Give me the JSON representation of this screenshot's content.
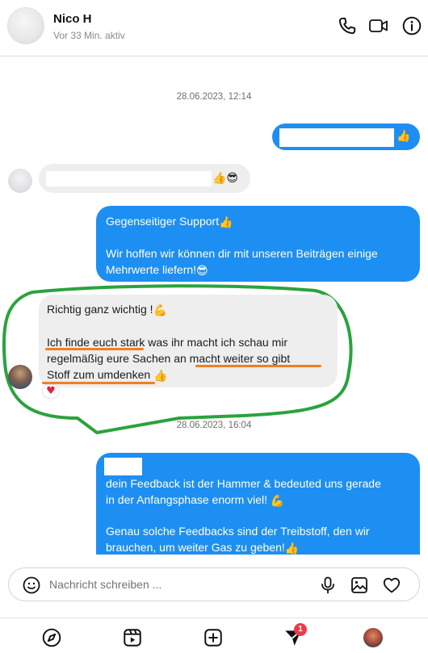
{
  "header": {
    "name": "Nico H",
    "status": "Vor 33 Min. aktiv"
  },
  "timestamps": {
    "first": "28.06.2023, 12:14",
    "second": "28.06.2023, 16:04"
  },
  "messages": {
    "out1": {
      "emoji": "👍"
    },
    "in1": {
      "emoji": "👍😎"
    },
    "out2": {
      "line1": "Gegenseitiger Support",
      "line1_emoji": "👍",
      "line2": "Wir hoffen wir können dir mit unseren Beiträgen einige",
      "line3": "Mehrwerte liefern!",
      "line3_emoji": "😎"
    },
    "in2": {
      "line1": "Richtig ganz wichtig !",
      "line1_emoji": "💪",
      "line2": "Ich finde euch stark was ihr macht ich schau mir",
      "line3": "regelmäßig eure Sachen an macht weiter so gibt",
      "line4": "Stoff zum umdenken",
      "line4_emoji": "👍",
      "reaction": "♥"
    },
    "out3": {
      "line1": "dein Feedback ist der Hammer & bedeuted uns gerade",
      "line2": "in der Anfangsphase enorm viel!",
      "line2_emoji": "💪",
      "line3": "Genau solche Feedbacks sind der Treibstoff, den wir",
      "line4": "brauchen, um weiter Gas zu geben!",
      "line4_emoji": "👍"
    }
  },
  "composer": {
    "placeholder": "Nachricht schreiben ..."
  },
  "nav": {
    "badge_count": "1"
  },
  "colors": {
    "outgoing_bubble": "#1d8ff2",
    "incoming_bubble": "#eeeeef",
    "highlight_outline": "#2aa33d",
    "underline": "#ef7f22",
    "badge": "#ed3a4b"
  },
  "icons": [
    "phone-icon",
    "video-camera-icon",
    "info-icon",
    "emoji-icon",
    "microphone-icon",
    "image-icon",
    "heart-icon",
    "explore-icon",
    "reels-icon",
    "new-post-icon",
    "direct-messages-icon"
  ]
}
